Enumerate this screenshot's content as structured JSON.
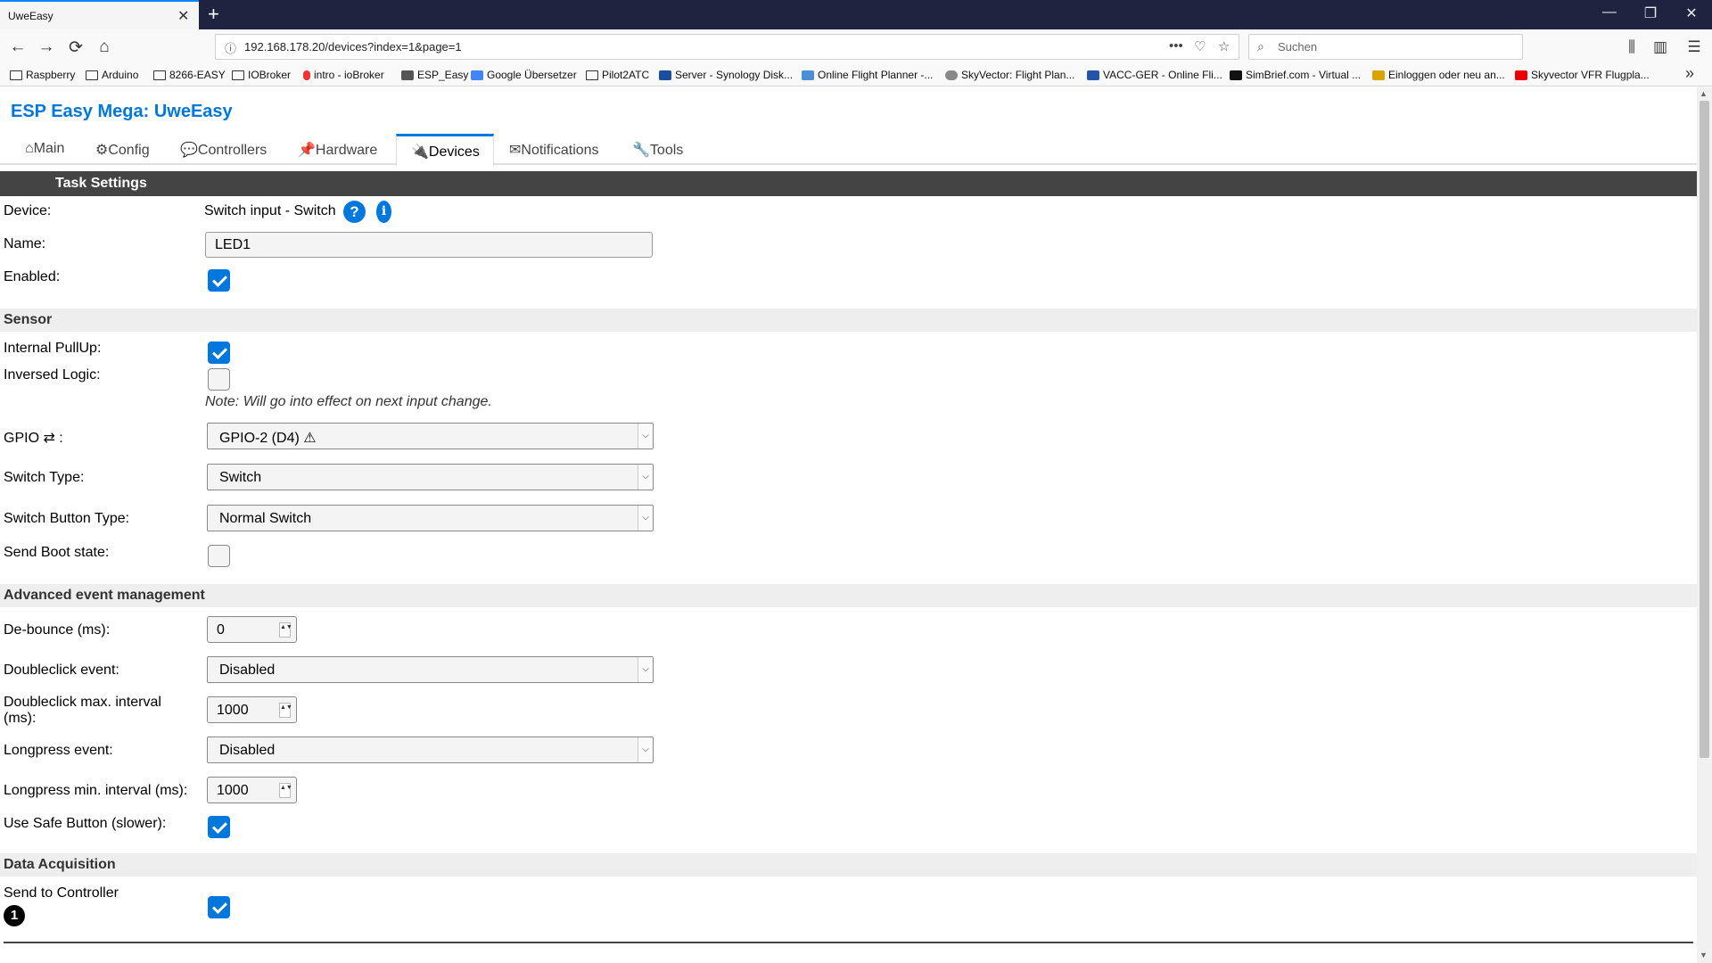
{
  "browser": {
    "tab_title": "UweEasy",
    "tab_close": "✕",
    "new_tab": "+",
    "url": "192.168.178.20/devices?index=1&page=1",
    "search_placeholder": "Suchen",
    "window_minimize": "—",
    "window_restore": "❐",
    "window_close": "✕",
    "nav_back": "←",
    "nav_forward": "→",
    "nav_reload": "⟳",
    "nav_home": "⌂",
    "page_actions": "•••",
    "pocket": "♡",
    "star": "☆",
    "library": "⫼",
    "sidebar": "▥",
    "menu": "☰",
    "search_glyph": "⌕",
    "info_glyph": "ⓘ",
    "more_bookmarks": "»",
    "bookmarks": [
      {
        "label": "Raspberry",
        "icon": "folder-icon"
      },
      {
        "label": "Arduino",
        "icon": "folder-icon"
      },
      {
        "label": "8266-EASY",
        "icon": "folder-icon"
      },
      {
        "label": "IOBroker",
        "icon": "folder-icon"
      },
      {
        "label": "intro - ioBroker",
        "icon": "iobroker-icon"
      },
      {
        "label": "ESP_Easy",
        "icon": "espeasy-icon"
      },
      {
        "label": "Google Übersetzer",
        "icon": "translate-icon"
      },
      {
        "label": "Pilot2ATC",
        "icon": "folder-icon"
      },
      {
        "label": "Server - Synology Disk...",
        "icon": "synology-icon"
      },
      {
        "label": "Online Flight Planner -...",
        "icon": "flightplanner-icon"
      },
      {
        "label": "SkyVector: Flight Plan...",
        "icon": "skyvector-icon"
      },
      {
        "label": "VACC-GER - Online Fli...",
        "icon": "vacc-icon"
      },
      {
        "label": "SimBrief.com - Virtual ...",
        "icon": "simbrief-icon"
      },
      {
        "label": "Einloggen oder neu an...",
        "icon": "login-icon"
      },
      {
        "label": "Skyvector VFR Flugpla...",
        "icon": "youtube-icon"
      }
    ]
  },
  "app": {
    "title": "ESP Easy Mega: UweEasy",
    "menu": [
      {
        "label": "⌂Main"
      },
      {
        "label": "⚙Config"
      },
      {
        "label": "💬Controllers"
      },
      {
        "label": "📌Hardware"
      },
      {
        "label": "🔌Devices"
      },
      {
        "label": "✉Notifications"
      },
      {
        "label": "🔧Tools"
      }
    ]
  },
  "task": {
    "header": "Task Settings",
    "device_label": "Device:",
    "device_value": "Switch input - Switch",
    "help_glyph": "?",
    "info_glyph": "i",
    "name_label": "Name:",
    "name_value": "LED1",
    "enabled_label": "Enabled:"
  },
  "sensor": {
    "header": "Sensor",
    "pullup_label": "Internal PullUp:",
    "inversed_label": "Inversed Logic:",
    "note": "Note: Will go into effect on next input change.",
    "gpio_label": "GPIO ⇄ :",
    "gpio_value": "GPIO-2 (D4) ⚠",
    "switch_type_label": "Switch Type:",
    "switch_type_value": "Switch",
    "button_type_label": "Switch Button Type:",
    "button_type_value": "Normal Switch",
    "boot_state_label": "Send Boot state:"
  },
  "advanced": {
    "header": "Advanced event management",
    "debounce_label": "De-bounce (ms):",
    "debounce_value": "0",
    "doubleclick_label": "Doubleclick event:",
    "doubleclick_value": "Disabled",
    "dc_interval_label_1": "Doubleclick max. interval",
    "dc_interval_label_2": "(ms):",
    "dc_interval_value": "1000",
    "longpress_label": "Longpress event:",
    "longpress_value": "Disabled",
    "lp_interval_label": "Longpress min. interval (ms):",
    "lp_interval_value": "1000",
    "safe_button_label": "Use Safe Button (slower):"
  },
  "acquisition": {
    "header": "Data Acquisition",
    "send_label": "Send to Controller",
    "controller_number": "1"
  },
  "spin_glyph": "▲▼",
  "select_arrow": "⌵"
}
